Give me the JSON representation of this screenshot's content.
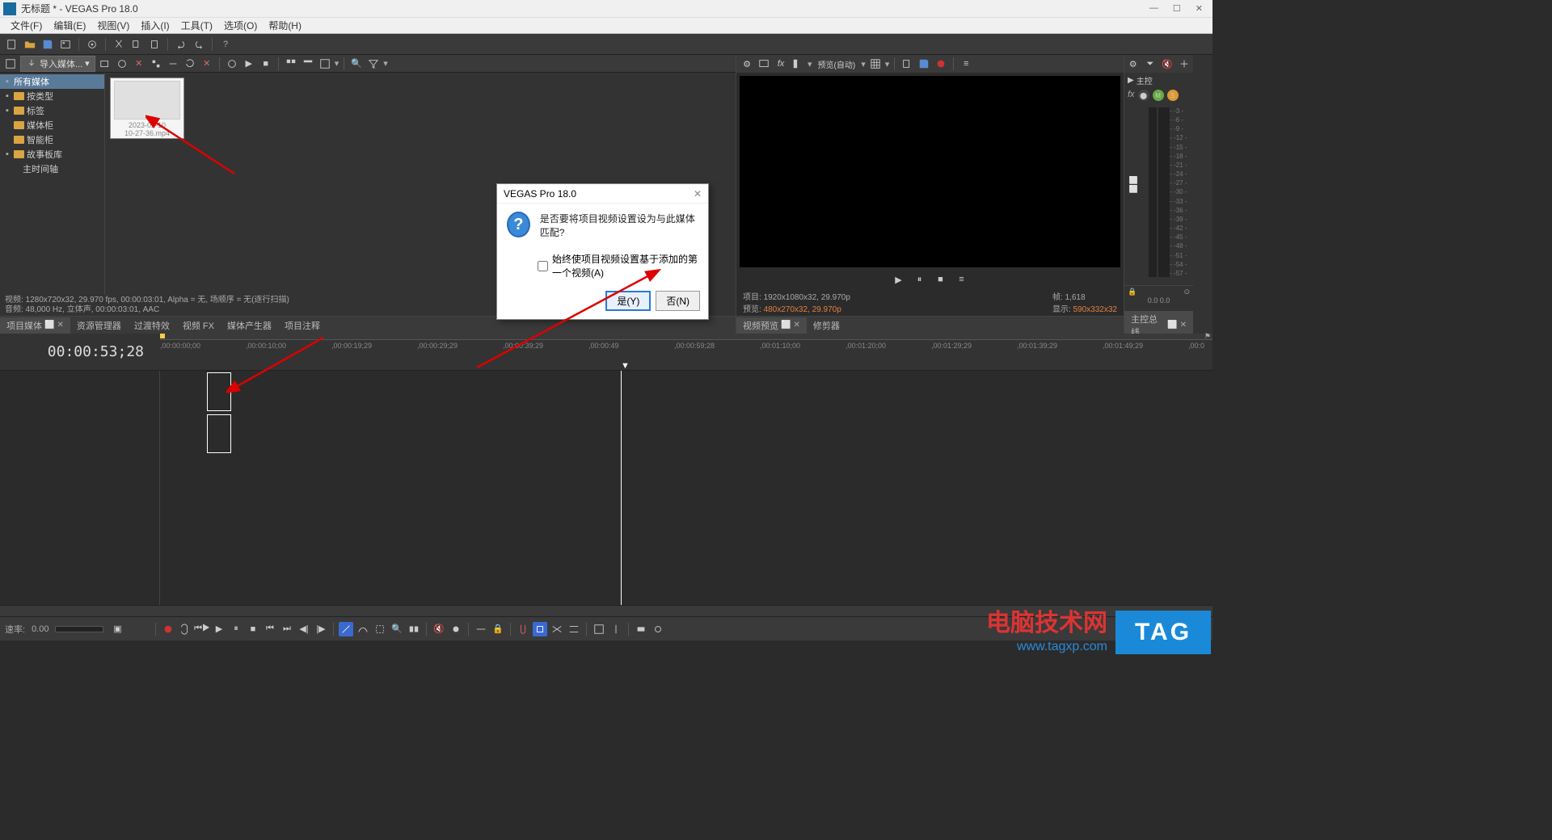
{
  "titlebar": {
    "title": "无标题 * - VEGAS Pro 18.0"
  },
  "menubar": {
    "items": [
      {
        "label": "文件(F)"
      },
      {
        "label": "编辑(E)"
      },
      {
        "label": "视图(V)"
      },
      {
        "label": "插入(I)"
      },
      {
        "label": "工具(T)"
      },
      {
        "label": "选项(O)"
      },
      {
        "label": "帮助(H)"
      }
    ]
  },
  "media": {
    "import_label": "导入媒体...",
    "tree": {
      "root": "所有媒体",
      "items": [
        {
          "label": "按类型"
        },
        {
          "label": "标签"
        },
        {
          "label": "媒体柜"
        },
        {
          "label": "智能柜"
        },
        {
          "label": "故事板库",
          "expanded": true,
          "children": [
            {
              "label": "主时间轴"
            }
          ]
        }
      ]
    },
    "thumb": {
      "name": "2023-02-10",
      "file": "10-27-36.mp4"
    },
    "info_video": "视频: 1280x720x32, 29.970 fps, 00:00:03:01, Alpha = 无, 场顺序 = 无(逐行扫描)",
    "info_audio": "音频: 48,000 Hz, 立体声, 00:00:03:01, AAC",
    "tabs": [
      "项目媒体",
      "资源管理器",
      "过渡特效",
      "视频 FX",
      "媒体产生器",
      "项目注释"
    ]
  },
  "preview": {
    "quality_label": "预览(自动)",
    "project_label": "项目:",
    "project_value": "1920x1080x32, 29.970p",
    "preview_label": "预览:",
    "preview_value": "480x270x32, 29.970p",
    "frame_label": "帧:",
    "frame_value": "1,618",
    "display_label": "显示:",
    "display_value": "590x332x32",
    "tabs": [
      "视频预览",
      "修剪器"
    ]
  },
  "master": {
    "title": "主控",
    "scale": [
      "-3",
      "-6",
      "-9",
      "-12",
      "-15",
      "-18",
      "-21",
      "-24",
      "-27",
      "-30",
      "-33",
      "-36",
      "-39",
      "-42",
      "-45",
      "-48",
      "-51",
      "-54",
      "-57"
    ],
    "readout": "0.0   0.0",
    "tab": "主控总线"
  },
  "timeline": {
    "timecode": "00:00:53;28",
    "ticks": [
      "00:00:00;00",
      "00:00:10;00",
      "00:00:19;29",
      "00:00:29;29",
      "00:00:39;29",
      "00:00:49",
      "00:00:59;28",
      "00:01:10;00",
      "00:01:20;00",
      "00:01:29;29",
      "00:01:39;29",
      "00:01:49;29",
      "00:0"
    ]
  },
  "transport": {
    "rate_label": "速率:",
    "rate_value": "0.00"
  },
  "dialog": {
    "title": "VEGAS Pro 18.0",
    "message": "是否要将项目视频设置设为与此媒体匹配?",
    "checkbox": "始终使项目视频设置基于添加的第一个视频(A)",
    "yes": "是(Y)",
    "no": "否(N)"
  },
  "watermark": {
    "text": "电脑技术网",
    "url": "www.tagxp.com",
    "tag": "TAG"
  },
  "icons": {
    "gear": "⚙",
    "folder": "📁",
    "play": "▶",
    "pause": "⏸",
    "stop": "■",
    "menu": "≡",
    "search": "🔍",
    "minimize": "—",
    "maximize": "☐",
    "close": "✕",
    "dropdown": "▾",
    "check": "✓"
  }
}
